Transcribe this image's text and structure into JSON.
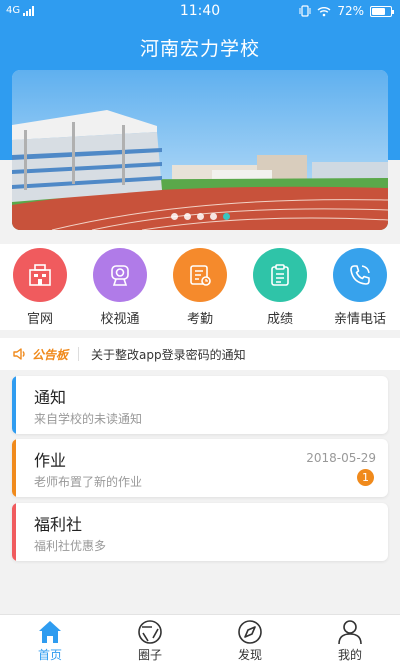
{
  "status_bar": {
    "network": "4G",
    "time": "11:40",
    "battery": "72%"
  },
  "header": {
    "title": "河南宏力学校"
  },
  "banner": {
    "slide_count": 5,
    "active_slide": 5
  },
  "quick_links": [
    {
      "label": "官网",
      "icon": "building-icon",
      "color": "#f05b5e"
    },
    {
      "label": "校视通",
      "icon": "camera-icon",
      "color": "#b07be8"
    },
    {
      "label": "考勤",
      "icon": "attendance-icon",
      "color": "#f58a2c"
    },
    {
      "label": "成绩",
      "icon": "clipboard-icon",
      "color": "#2fc4a8"
    },
    {
      "label": "亲情电话",
      "icon": "phone-icon",
      "color": "#37a2ec"
    }
  ],
  "notice": {
    "tag": "公告板",
    "text": "关于整改app登录密码的通知"
  },
  "cards": [
    {
      "title": "通知",
      "subtitle": "来自学校的未读通知",
      "date": "",
      "badge": "",
      "color": "#2f9cf0"
    },
    {
      "title": "作业",
      "subtitle": "老师布置了新的作业",
      "date": "2018-05-29",
      "badge": "1",
      "color": "#f08a1c"
    },
    {
      "title": "福利社",
      "subtitle": "福利社优惠多",
      "date": "",
      "badge": "",
      "color": "#f05b5e"
    }
  ],
  "tabbar": {
    "items": [
      {
        "label": "首页",
        "icon": "home-icon",
        "active": true
      },
      {
        "label": "圈子",
        "icon": "circle-icon",
        "active": false
      },
      {
        "label": "发现",
        "icon": "compass-icon",
        "active": false
      },
      {
        "label": "我的",
        "icon": "person-icon",
        "active": false
      }
    ],
    "active_color": "#2f9cf0"
  }
}
